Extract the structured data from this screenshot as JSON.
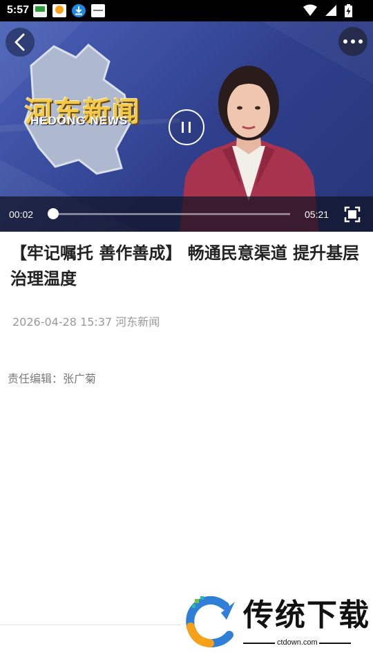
{
  "status_bar": {
    "time": "5:57",
    "icons": [
      "app-notification-icon",
      "app-notification-icon",
      "download-icon",
      "app-notification-icon",
      "wifi-icon",
      "signal-icon",
      "battery-charging-icon"
    ]
  },
  "video": {
    "logo_cn": "河东新闻",
    "logo_en": "HEDONG NEWS",
    "current_time": "00:02",
    "total_time": "05:21",
    "progress": 0.006
  },
  "article": {
    "title": "【牢记嘱托  善作善成】 畅通民意渠道  提升基层治理温度",
    "meta": "2026-04-28 15:37 河东新闻",
    "editor": "责任编辑：张广菊"
  },
  "watermark": {
    "name": "传统下载",
    "url": "ctdown.com"
  },
  "colors": {
    "video_bg": "#2f3f8c",
    "logo_gold": "#f3c94a",
    "title_text": "#222222",
    "meta_text": "#9a9a9a"
  }
}
